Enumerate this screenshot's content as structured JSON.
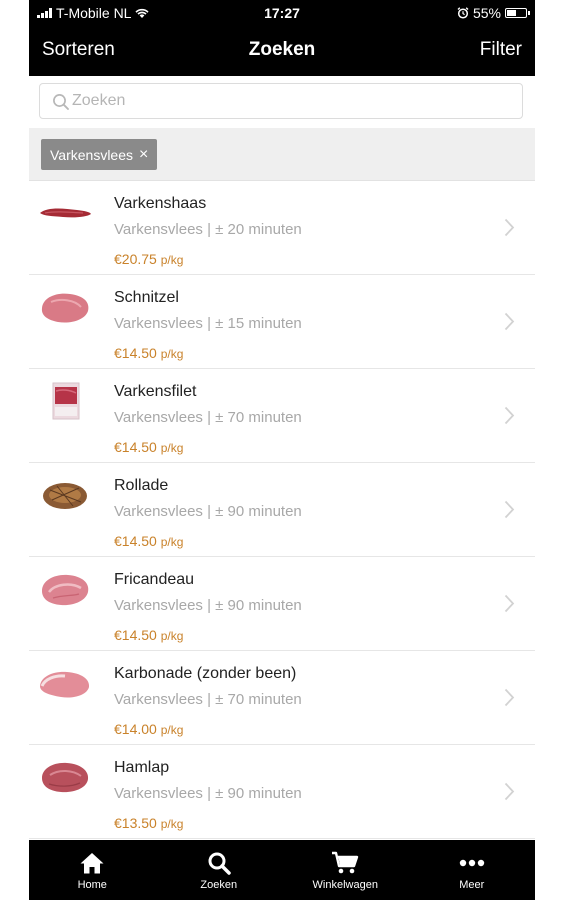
{
  "status_bar": {
    "carrier": "T-Mobile NL",
    "time": "17:27",
    "battery": "55%",
    "battery_level": 0.55,
    "icons": [
      "signal-icon",
      "wifi-icon",
      "alarm-icon",
      "battery-icon"
    ]
  },
  "nav": {
    "sort_label": "Sorteren",
    "title": "Zoeken",
    "filter_label": "Filter"
  },
  "search": {
    "placeholder": "Zoeken",
    "value": ""
  },
  "active_filter": {
    "label": "Varkensvlees",
    "remove_glyph": "×"
  },
  "colors": {
    "header": "#000000",
    "price": "#c9822a",
    "meta_text": "#a8a8a8",
    "chip": "#8a8a8a"
  },
  "products": [
    {
      "name": "Varkenshaas",
      "meta": "Varkensvlees | ± 20 minuten",
      "price": "€20.75",
      "unit": "p/kg",
      "thumb_icon": "pork-tenderloin-image"
    },
    {
      "name": "Schnitzel",
      "meta": "Varkensvlees | ± 15 minuten",
      "price": "€14.50",
      "unit": "p/kg",
      "thumb_icon": "schnitzel-image"
    },
    {
      "name": "Varkensfilet",
      "meta": "Varkensvlees | ± 70 minuten",
      "price": "€14.50",
      "unit": "p/kg",
      "thumb_icon": "pork-fillet-package-image"
    },
    {
      "name": "Rollade",
      "meta": "Varkensvlees | ± 90 minuten",
      "price": "€14.50",
      "unit": "p/kg",
      "thumb_icon": "rollade-image"
    },
    {
      "name": "Fricandeau",
      "meta": "Varkensvlees | ± 90 minuten",
      "price": "€14.50",
      "unit": "p/kg",
      "thumb_icon": "fricandeau-image"
    },
    {
      "name": "Karbonade (zonder been)",
      "meta": "Varkensvlees | ± 70 minuten",
      "price": "€14.00",
      "unit": "p/kg",
      "thumb_icon": "pork-chop-image"
    },
    {
      "name": "Hamlap",
      "meta": "Varkensvlees | ± 90 minuten",
      "price": "€13.50",
      "unit": "p/kg",
      "thumb_icon": "hamlap-image"
    }
  ],
  "tabs": [
    {
      "label": "Home",
      "icon": "home-icon"
    },
    {
      "label": "Zoeken",
      "icon": "search-icon"
    },
    {
      "label": "Winkelwagen",
      "icon": "cart-icon"
    },
    {
      "label": "Meer",
      "icon": "more-icon"
    }
  ]
}
